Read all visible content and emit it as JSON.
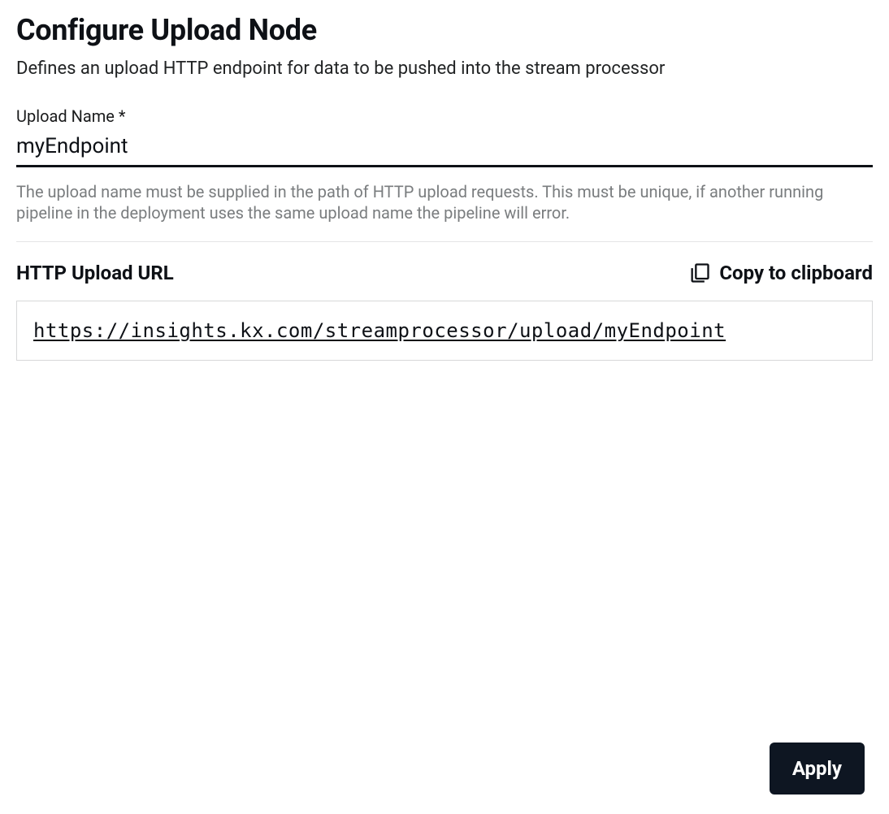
{
  "header": {
    "title": "Configure Upload Node",
    "subtitle": "Defines an upload HTTP endpoint for data to be pushed into the stream processor"
  },
  "form": {
    "upload_name": {
      "label": "Upload Name *",
      "value": "myEndpoint",
      "helper": "The upload name must be supplied in the path of HTTP upload requests. This must be unique, if another running pipeline in the deployment uses the same upload name the pipeline will error."
    },
    "upload_url": {
      "label": "HTTP Upload URL",
      "copy_label": "Copy to clipboard",
      "value": "https://insights.kx.com/streamprocessor/upload/myEndpoint"
    }
  },
  "actions": {
    "apply_label": "Apply"
  }
}
